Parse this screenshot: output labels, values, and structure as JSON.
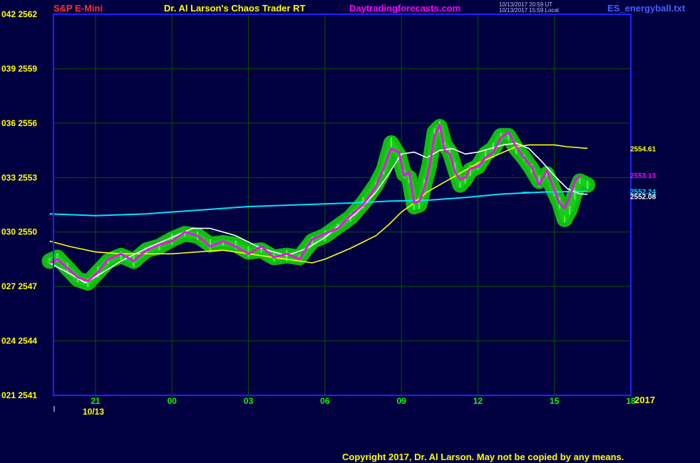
{
  "header": {
    "instrument": "S&P E-Mini",
    "title": "Dr. Al Larson's Chaos Trader RT",
    "website": "Daytradingforecasts.com",
    "timestamp_ut": "10/13/2017 20:59 UT",
    "timestamp_local": "10/13/2017 15:59 Local",
    "data_file": "ES_energyball.txt"
  },
  "footer": {
    "copyright": "Copyright 2017, Dr. Al Larson. May not be copied by any means."
  },
  "colors": {
    "background": "#000040",
    "plot_border": "#2020ff",
    "grid": "#005500",
    "energy_ball": "#11bb11",
    "price_bars": "#44ff44",
    "axis_time_labels": "#00ff00",
    "axis_price_labels": "#ffff00",
    "white_ma": "#ffffff",
    "yellow_ma": "#ffff00",
    "cyan_ma": "#00e5ff",
    "magenta_line": "#ff00ff"
  },
  "chart_data": {
    "type": "line",
    "ylim": [
      2541,
      2562
    ],
    "xlim": [
      19.35,
      19.35
    ],
    "y_ticks": [
      {
        "value": 2562,
        "label": "042  2562"
      },
      {
        "value": 2559,
        "label": "039  2559"
      },
      {
        "value": 2556,
        "label": "036  2556"
      },
      {
        "value": 2553,
        "label": "033  2553"
      },
      {
        "value": 2550,
        "label": "030  2550"
      },
      {
        "value": 2547,
        "label": "027  2547"
      },
      {
        "value": 2544,
        "label": "024  2544"
      },
      {
        "value": 2541,
        "label": "021  2541"
      }
    ],
    "x_ticks": [
      {
        "value": 21,
        "label": "21"
      },
      {
        "value": 24,
        "label": "00"
      },
      {
        "value": 27,
        "label": "03"
      },
      {
        "value": 30,
        "label": "06"
      },
      {
        "value": 33,
        "label": "09"
      },
      {
        "value": 36,
        "label": "12"
      },
      {
        "value": 39,
        "label": "15"
      },
      {
        "value": 42,
        "label": "18"
      }
    ],
    "date_label": "10/13",
    "year_label": "2017",
    "right_labels": [
      {
        "value": 2554.61,
        "text": "2554.61",
        "series": "yellow"
      },
      {
        "value": 2553.13,
        "text": "2553.13",
        "series": "magenta"
      },
      {
        "value": 2552.24,
        "text": "2552.24",
        "series": "cyan"
      },
      {
        "value": 2552.08,
        "text": "2552.08",
        "series": "white"
      }
    ],
    "series": [
      {
        "key": "price",
        "values": [
          [
            19.2,
            2548.4
          ],
          [
            19.5,
            2548.6
          ],
          [
            19.9,
            2548
          ],
          [
            20.3,
            2547.4
          ],
          [
            20.7,
            2547.2
          ],
          [
            21.1,
            2547.8
          ],
          [
            21.5,
            2548.4
          ],
          [
            22.0,
            2548.7
          ],
          [
            22.5,
            2548.4
          ],
          [
            23.0,
            2549
          ],
          [
            23.5,
            2549.2
          ],
          [
            24.0,
            2549.6
          ],
          [
            24.5,
            2549.9
          ],
          [
            25.0,
            2549.8
          ],
          [
            25.5,
            2549.3
          ],
          [
            26.0,
            2549.4
          ],
          [
            26.5,
            2549.3
          ],
          [
            27.0,
            2548.9
          ],
          [
            27.5,
            2549
          ],
          [
            28.0,
            2548.6
          ],
          [
            28.5,
            2548.7
          ],
          [
            29.0,
            2548.6
          ],
          [
            29.5,
            2549.5
          ],
          [
            30.0,
            2549.8
          ],
          [
            30.5,
            2550.3
          ],
          [
            31.0,
            2550.8
          ],
          [
            31.5,
            2551.6
          ],
          [
            32.0,
            2552.6
          ],
          [
            32.3,
            2553.4
          ],
          [
            32.6,
            2554.9
          ],
          [
            32.9,
            2554.2
          ],
          [
            33.1,
            2553.2
          ],
          [
            33.3,
            2553
          ],
          [
            33.5,
            2551.4
          ],
          [
            33.7,
            2551.5
          ],
          [
            33.9,
            2552.6
          ],
          [
            34.1,
            2553.7
          ],
          [
            34.3,
            2555.5
          ],
          [
            34.5,
            2555.8
          ],
          [
            34.7,
            2554.8
          ],
          [
            34.9,
            2554.4
          ],
          [
            35.1,
            2553.5
          ],
          [
            35.3,
            2552.6
          ],
          [
            35.5,
            2552.9
          ],
          [
            35.7,
            2553.4
          ],
          [
            36.0,
            2553.6
          ],
          [
            36.3,
            2554.3
          ],
          [
            36.6,
            2554.6
          ],
          [
            36.9,
            2555.3
          ],
          [
            37.2,
            2555.3
          ],
          [
            37.5,
            2554.6
          ],
          [
            37.8,
            2554.1
          ],
          [
            38.1,
            2553.5
          ],
          [
            38.4,
            2552.8
          ],
          [
            38.7,
            2553.2
          ],
          [
            39.0,
            2552.2
          ],
          [
            39.2,
            2551.6
          ],
          [
            39.4,
            2550.7
          ],
          [
            39.6,
            2551.2
          ],
          [
            39.8,
            2552.1
          ],
          [
            40.0,
            2552.8
          ],
          [
            40.3,
            2552.6
          ]
        ]
      },
      {
        "key": "white",
        "values": [
          [
            19.2,
            2548.3
          ],
          [
            20.0,
            2547.7
          ],
          [
            20.6,
            2547.2
          ],
          [
            21.2,
            2547.7
          ],
          [
            22.0,
            2548.4
          ],
          [
            23.0,
            2549.1
          ],
          [
            24.0,
            2549.7
          ],
          [
            24.8,
            2550.2
          ],
          [
            25.5,
            2550.2
          ],
          [
            26.5,
            2549.8
          ],
          [
            27.5,
            2549.1
          ],
          [
            28.5,
            2548.7
          ],
          [
            29.3,
            2549.1
          ],
          [
            30.0,
            2549.7
          ],
          [
            30.5,
            2550.3
          ],
          [
            31.2,
            2551
          ],
          [
            32.0,
            2552.2
          ],
          [
            32.5,
            2553.2
          ],
          [
            33.0,
            2554.3
          ],
          [
            33.5,
            2554.4
          ],
          [
            34.0,
            2554.1
          ],
          [
            34.5,
            2554.5
          ],
          [
            35.0,
            2554.6
          ],
          [
            35.5,
            2554.3
          ],
          [
            36.0,
            2554.4
          ],
          [
            36.5,
            2554.6
          ],
          [
            37.0,
            2554.8
          ],
          [
            37.5,
            2554.9
          ],
          [
            38.0,
            2554.6
          ],
          [
            38.5,
            2553.9
          ],
          [
            39.0,
            2553.1
          ],
          [
            39.5,
            2552.4
          ],
          [
            40.0,
            2552.1
          ],
          [
            40.3,
            2552.08
          ]
        ]
      },
      {
        "key": "yellow",
        "values": [
          [
            19.2,
            2549.5
          ],
          [
            20.0,
            2549.2
          ],
          [
            21.0,
            2548.9
          ],
          [
            22.0,
            2548.8
          ],
          [
            23.0,
            2548.8
          ],
          [
            24.0,
            2548.8
          ],
          [
            25.0,
            2548.9
          ],
          [
            26.0,
            2549
          ],
          [
            27.0,
            2548.8
          ],
          [
            28.0,
            2548.6
          ],
          [
            29.0,
            2548.4
          ],
          [
            29.5,
            2548.3
          ],
          [
            30.0,
            2548.5
          ],
          [
            31.0,
            2549.1
          ],
          [
            32.0,
            2549.8
          ],
          [
            32.5,
            2550.4
          ],
          [
            33.0,
            2551.1
          ],
          [
            33.5,
            2551.6
          ],
          [
            34.0,
            2552.2
          ],
          [
            35.0,
            2553
          ],
          [
            36.0,
            2553.8
          ],
          [
            37.0,
            2554.4
          ],
          [
            37.5,
            2554.7
          ],
          [
            38.0,
            2554.8
          ],
          [
            39.0,
            2554.8
          ],
          [
            39.5,
            2554.7
          ],
          [
            40.3,
            2554.61
          ]
        ]
      },
      {
        "key": "cyan",
        "values": [
          [
            19.2,
            2551
          ],
          [
            21.0,
            2550.9
          ],
          [
            23.0,
            2551
          ],
          [
            25.0,
            2551.2
          ],
          [
            27.0,
            2551.4
          ],
          [
            29.0,
            2551.5
          ],
          [
            31.0,
            2551.6
          ],
          [
            32.5,
            2551.7
          ],
          [
            34.0,
            2551.75
          ],
          [
            35.5,
            2551.9
          ],
          [
            37.0,
            2552.1
          ],
          [
            38.5,
            2552.2
          ],
          [
            40.3,
            2552.24
          ]
        ]
      },
      {
        "key": "magenta",
        "values": [
          [
            19.2,
            2548.3
          ],
          [
            19.5,
            2548.5
          ],
          [
            19.9,
            2548
          ],
          [
            20.3,
            2547.5
          ],
          [
            20.7,
            2547.3
          ],
          [
            21.1,
            2547.8
          ],
          [
            21.5,
            2548.5
          ],
          [
            22.0,
            2548.8
          ],
          [
            22.5,
            2548.4
          ],
          [
            23.0,
            2549
          ],
          [
            23.5,
            2549.3
          ],
          [
            24.0,
            2549.5
          ],
          [
            24.5,
            2550
          ],
          [
            25.0,
            2549.8
          ],
          [
            25.5,
            2549.2
          ],
          [
            26.0,
            2549.5
          ],
          [
            26.5,
            2549.2
          ],
          [
            27.0,
            2548.8
          ],
          [
            27.5,
            2549.2
          ],
          [
            28.0,
            2548.6
          ],
          [
            28.5,
            2548.8
          ],
          [
            29.0,
            2548.5
          ],
          [
            29.5,
            2549.6
          ],
          [
            30.0,
            2549.9
          ],
          [
            30.5,
            2550.2
          ],
          [
            31.0,
            2550.9
          ],
          [
            31.5,
            2551.5
          ],
          [
            32.0,
            2552.5
          ],
          [
            32.3,
            2553.5
          ],
          [
            32.6,
            2554.6
          ],
          [
            32.9,
            2554.4
          ],
          [
            33.1,
            2553.1
          ],
          [
            33.3,
            2553.3
          ],
          [
            33.5,
            2551.6
          ],
          [
            33.7,
            2551.7
          ],
          [
            33.9,
            2552.4
          ],
          [
            34.1,
            2553.6
          ],
          [
            34.3,
            2555.3
          ],
          [
            34.5,
            2555.9
          ],
          [
            34.7,
            2554.5
          ],
          [
            34.9,
            2554.3
          ],
          [
            35.1,
            2553.3
          ],
          [
            35.3,
            2552.9
          ],
          [
            35.5,
            2553
          ],
          [
            35.7,
            2553.5
          ],
          [
            36.0,
            2553.6
          ],
          [
            36.3,
            2554.1
          ],
          [
            36.6,
            2554.4
          ],
          [
            36.9,
            2555.2
          ],
          [
            37.2,
            2555.5
          ],
          [
            37.5,
            2554.7
          ],
          [
            37.8,
            2554.1
          ],
          [
            38.1,
            2553.6
          ],
          [
            38.4,
            2552.6
          ],
          [
            38.7,
            2553.4
          ],
          [
            39.0,
            2552.3
          ],
          [
            39.2,
            2551.6
          ],
          [
            39.4,
            2551.3
          ],
          [
            39.6,
            2551.9
          ],
          [
            39.8,
            2552.8
          ],
          [
            40.0,
            2553.13
          ]
        ]
      }
    ]
  }
}
